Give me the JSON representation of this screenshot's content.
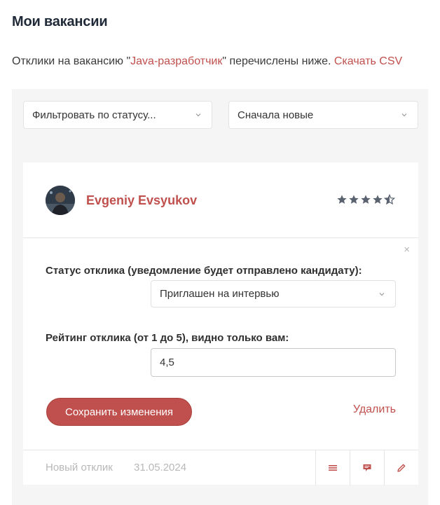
{
  "page": {
    "title": "Мои вакансии",
    "intro_prefix": "Отклики на вакансию \"",
    "vacancy_name": "Java-разработчик",
    "intro_suffix": "\" перечислены ниже. ",
    "download_link": "Скачать CSV"
  },
  "filters": {
    "status_placeholder": "Фильтровать по статусу...",
    "sort_value": "Сначала новые"
  },
  "candidate": {
    "name": "Evgeniy Evsyukov",
    "rating_stars": 4.5
  },
  "edit_form": {
    "close": "×",
    "status_label": "Статус отклика (уведомление будет отправлено кандидату):",
    "status_value": "Приглашен на интервью",
    "rating_label": "Рейтинг отклика (от 1 до 5), видно только вам:",
    "rating_value": "4,5",
    "save_label": "Сохранить изменения",
    "delete_label": "Удалить"
  },
  "footer": {
    "status": "Новый отклик",
    "date": "31.05.2024",
    "icons": [
      "menu-icon",
      "comment-icon",
      "pencil-icon"
    ]
  },
  "colors": {
    "accent": "#c0504d",
    "star": "#5a6270"
  }
}
